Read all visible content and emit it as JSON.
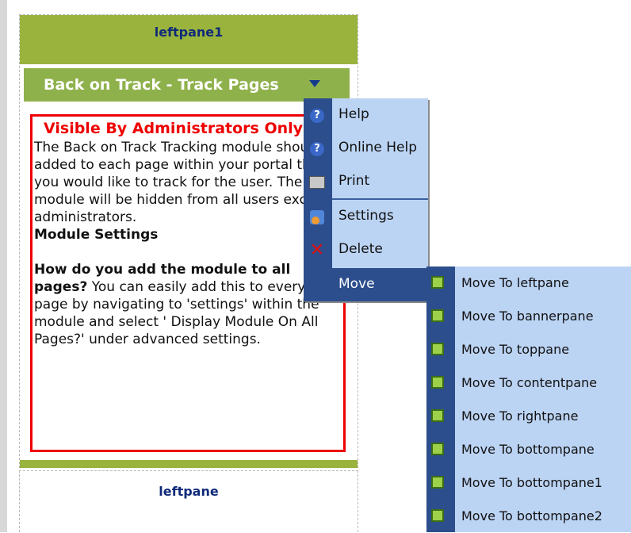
{
  "panes": {
    "top_title": "leftpane1",
    "bottom_title": "leftpane"
  },
  "module": {
    "title": "Back on Track - Track Pages",
    "admin_notice": "Visible By Administrators Only",
    "description": "The Back on Track Tracking module should be added to each page within your portal that you would like to track for the user. The module will be hidden from all users except administrators.",
    "settings_heading": "Module Settings",
    "faq_question": "How do you add the module to all pages?",
    "faq_answer": " You can easily add this to every page by navigating to 'settings' within the module and select ' Display Module On All Pages?' under advanced settings."
  },
  "menu": {
    "items": [
      {
        "label": "Help",
        "icon": "help-icon"
      },
      {
        "label": "Online Help",
        "icon": "online-help-icon"
      },
      {
        "label": "Print",
        "icon": "print-icon"
      },
      {
        "label": "Settings",
        "icon": "settings-icon"
      },
      {
        "label": "Delete",
        "icon": "delete-icon"
      },
      {
        "label": "Move",
        "icon": ""
      }
    ]
  },
  "submenu": {
    "items": [
      {
        "label": "Move To leftpane"
      },
      {
        "label": "Move To bannerpane"
      },
      {
        "label": "Move To toppane"
      },
      {
        "label": "Move To contentpane"
      },
      {
        "label": "Move To rightpane"
      },
      {
        "label": "Move To bottompane"
      },
      {
        "label": "Move To bottompane1"
      },
      {
        "label": "Move To bottompane2"
      }
    ]
  },
  "colors": {
    "pane_green": "#99b33d",
    "menu_blue": "#2c4e8c",
    "menu_light": "#bcd4f4",
    "admin_red": "#ee0000"
  }
}
